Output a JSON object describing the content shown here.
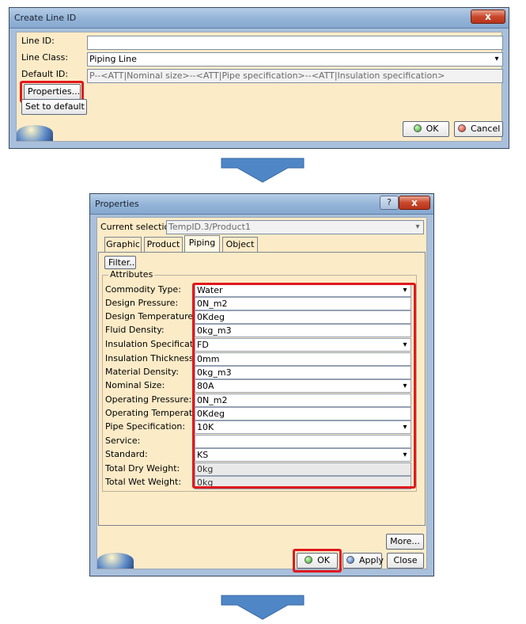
{
  "create_dialog": {
    "title": "Create Line ID",
    "close_label": "x",
    "line_id_label": "Line ID:",
    "line_id_value": "",
    "line_class_label": "Line Class:",
    "line_class_value": "Piping Line",
    "default_id_label": "Default ID:",
    "default_id_value": "P--<ATT|Nominal size>--<ATT|Pipe specification>--<ATT|Insulation  specification>",
    "properties_button": "Properties...",
    "set_default_button": "Set to default",
    "ok_button": "OK",
    "cancel_button": "Cancel"
  },
  "properties_dialog": {
    "title": "Properties",
    "help_label": "?",
    "close_label": "x",
    "current_selection_label": "Current selection :",
    "current_selection_value": "TempID.3/Product1",
    "tabs": [
      {
        "label": "Graphic"
      },
      {
        "label": "Product"
      },
      {
        "label": "Piping"
      },
      {
        "label": "Object"
      }
    ],
    "active_tab": "Piping",
    "filter_button": "Filter..",
    "attributes_group": "Attributes",
    "attributes": [
      {
        "name": "Commodity Type:",
        "value": "Water",
        "dropdown": true,
        "readonly": false
      },
      {
        "name": "Design Pressure:",
        "value": "0N_m2",
        "dropdown": false,
        "readonly": false
      },
      {
        "name": "Design Temperature:",
        "value": "0Kdeg",
        "dropdown": false,
        "readonly": false
      },
      {
        "name": "Fluid Density:",
        "value": "0kg_m3",
        "dropdown": false,
        "readonly": false
      },
      {
        "name": "Insulation Specification:",
        "value": "FD",
        "dropdown": true,
        "readonly": false
      },
      {
        "name": "Insulation Thickness:",
        "value": "0mm",
        "dropdown": false,
        "readonly": false
      },
      {
        "name": "Material Density:",
        "value": "0kg_m3",
        "dropdown": false,
        "readonly": false
      },
      {
        "name": "Nominal Size:",
        "value": "80A",
        "dropdown": true,
        "readonly": false
      },
      {
        "name": "Operating Pressure:",
        "value": "0N_m2",
        "dropdown": false,
        "readonly": false
      },
      {
        "name": "Operating Temperature:",
        "value": "0Kdeg",
        "dropdown": false,
        "readonly": false
      },
      {
        "name": "Pipe Specification:",
        "value": "10K",
        "dropdown": true,
        "readonly": false
      },
      {
        "name": "Service:",
        "value": "",
        "dropdown": false,
        "readonly": false
      },
      {
        "name": "Standard:",
        "value": "KS",
        "dropdown": true,
        "readonly": false
      },
      {
        "name": "Total Dry Weight:",
        "value": "0kg",
        "dropdown": false,
        "readonly": true
      },
      {
        "name": "Total Wet Weight:",
        "value": "0kg",
        "dropdown": false,
        "readonly": true
      }
    ],
    "more_button": "More...",
    "ok_button": "OK",
    "apply_button": "Apply",
    "close_button": "Close"
  },
  "colors": {
    "dialog_background": "#fcebc7",
    "titlebar": "#93b3d7",
    "highlight": "#e0191d",
    "arrow": "#4f86c6"
  }
}
